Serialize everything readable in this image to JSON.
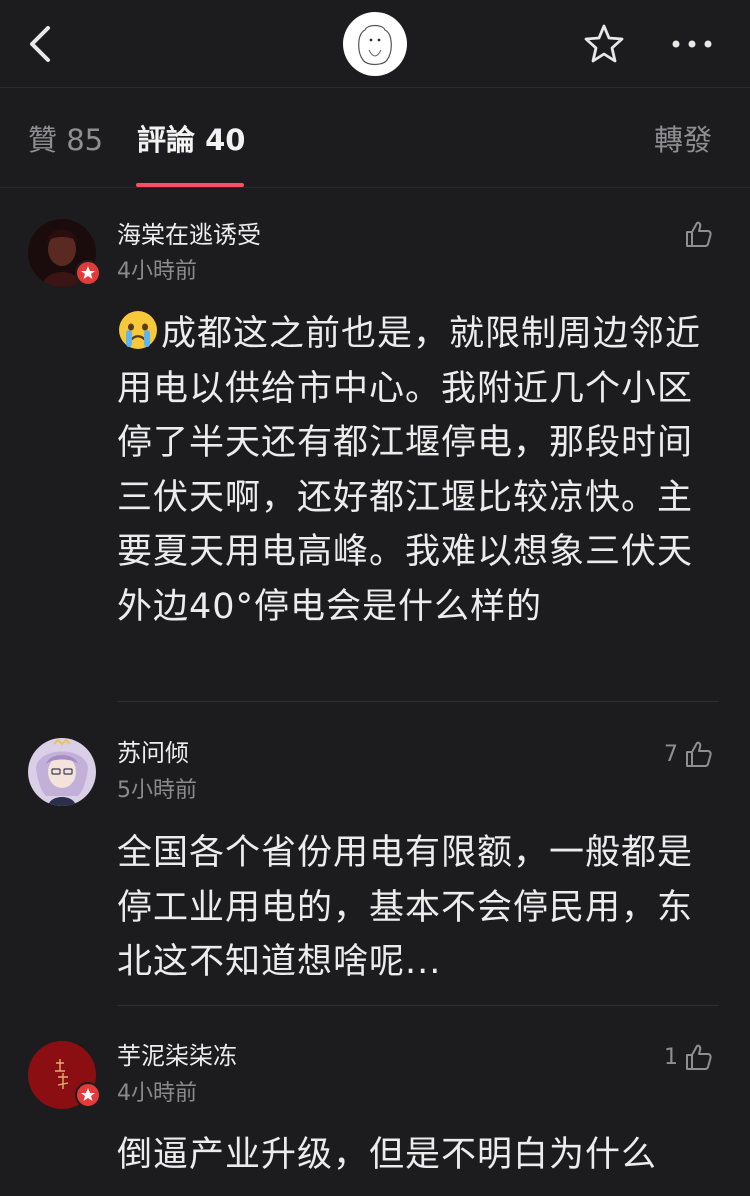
{
  "header": {
    "back_icon": "chevron-left-icon",
    "star_icon": "star-icon",
    "more_icon": "ellipsis-icon"
  },
  "tabs": {
    "likes": "贊 85",
    "comments": "評論 40",
    "reposts": "轉發"
  },
  "colors": {
    "background": "#1c1c1e",
    "accent": "#ff4f64",
    "badge": "#e53a3a"
  },
  "comments": [
    {
      "username": "海棠在逃诱受",
      "time": "4小時前",
      "likes": "",
      "text": "成都这之前也是，就限制周边邻近用电以供给市中心。我附近几个小区停了半天还有都江堰停电，那段时间三伏天啊，还好都江堰比较凉快。主要夏天用电高峰。我难以想象三伏天外边40°停电会是什么样的",
      "emoji": "crying-face-emoji"
    },
    {
      "username": "苏问倾",
      "time": "5小時前",
      "likes": "7",
      "text": "全国各个省份用电有限额，一般都是停工业用电的，基本不会停民用，东北这不知道想啥呢..."
    },
    {
      "username": "芋泥柒柒冻",
      "time": "4小時前",
      "likes": "1",
      "text": "倒逼产业升级，但是不明白为什么"
    }
  ]
}
